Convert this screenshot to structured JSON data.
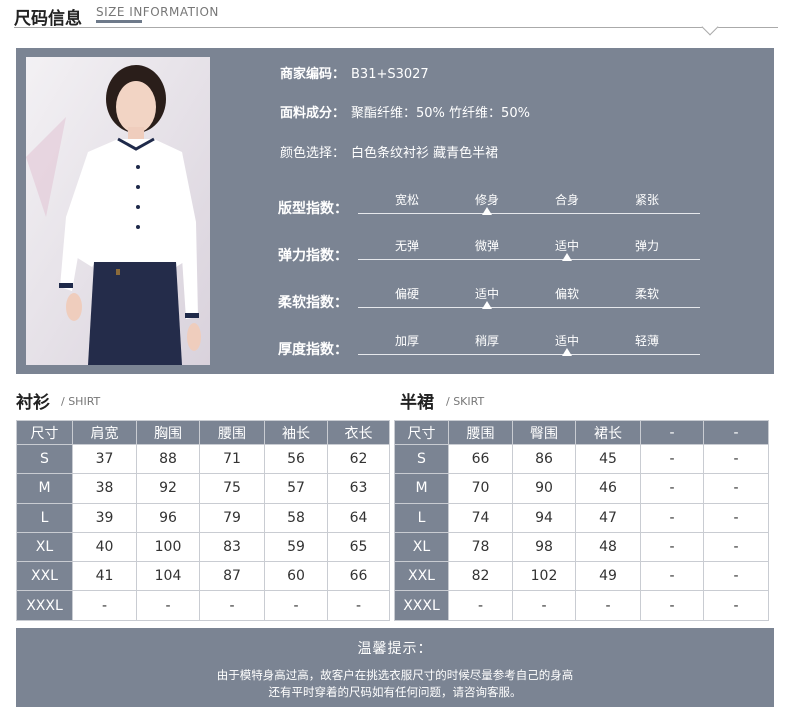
{
  "header": {
    "title": "尺码信息",
    "subtitle": "SIZE INFORMATION"
  },
  "product": {
    "code_label": "商家编码：",
    "code_value": "B31+S3027",
    "fabric_label": "面料成分：",
    "fabric_value": "聚酯纤维：50% 竹纤维：50%",
    "color_label": "颜色选择：",
    "color_value": "白色条纹衬衫 藏青色半裙"
  },
  "indices": [
    {
      "label": "版型指数：",
      "options": [
        "宽松",
        "修身",
        "合身",
        "紧张"
      ],
      "selected": 1
    },
    {
      "label": "弹力指数：",
      "options": [
        "无弹",
        "微弹",
        "适中",
        "弹力"
      ],
      "selected": 2
    },
    {
      "label": "柔软指数：",
      "options": [
        "偏硬",
        "适中",
        "偏软",
        "柔软"
      ],
      "selected": 1
    },
    {
      "label": "厚度指数：",
      "options": [
        "加厚",
        "稍厚",
        "适中",
        "轻薄"
      ],
      "selected": 2
    }
  ],
  "shirt": {
    "title": "衬衫",
    "subtitle": "/ SHIRT",
    "headers": [
      "尺寸",
      "肩宽",
      "胸围",
      "腰围",
      "袖长",
      "衣长"
    ],
    "rows": [
      [
        "S",
        "37",
        "88",
        "71",
        "56",
        "62"
      ],
      [
        "M",
        "38",
        "92",
        "75",
        "57",
        "63"
      ],
      [
        "L",
        "39",
        "96",
        "79",
        "58",
        "64"
      ],
      [
        "XL",
        "40",
        "100",
        "83",
        "59",
        "65"
      ],
      [
        "XXL",
        "41",
        "104",
        "87",
        "60",
        "66"
      ],
      [
        "XXXL",
        "-",
        "-",
        "-",
        "-",
        "-"
      ]
    ]
  },
  "skirt": {
    "title": "半裙",
    "subtitle": "/ SKIRT",
    "headers": [
      "尺寸",
      "腰围",
      "臀围",
      "裙长",
      "-",
      "-"
    ],
    "rows": [
      [
        "S",
        "66",
        "86",
        "45",
        "-",
        "-"
      ],
      [
        "M",
        "70",
        "90",
        "46",
        "-",
        "-"
      ],
      [
        "L",
        "74",
        "94",
        "47",
        "-",
        "-"
      ],
      [
        "XL",
        "78",
        "98",
        "48",
        "-",
        "-"
      ],
      [
        "XXL",
        "82",
        "102",
        "49",
        "-",
        "-"
      ],
      [
        "XXXL",
        "-",
        "-",
        "-",
        "-",
        "-"
      ]
    ]
  },
  "notice": {
    "title": "温馨提示：",
    "line1": "由于模特身高过高，故客户在挑选衣服尺寸的时候尽量参考自己的身高",
    "line2": "还有平时穿着的尺码如有任何问题，请咨询客服。"
  },
  "colors": {
    "panel": "#7b8493",
    "text_on_panel": "#ffffff"
  }
}
